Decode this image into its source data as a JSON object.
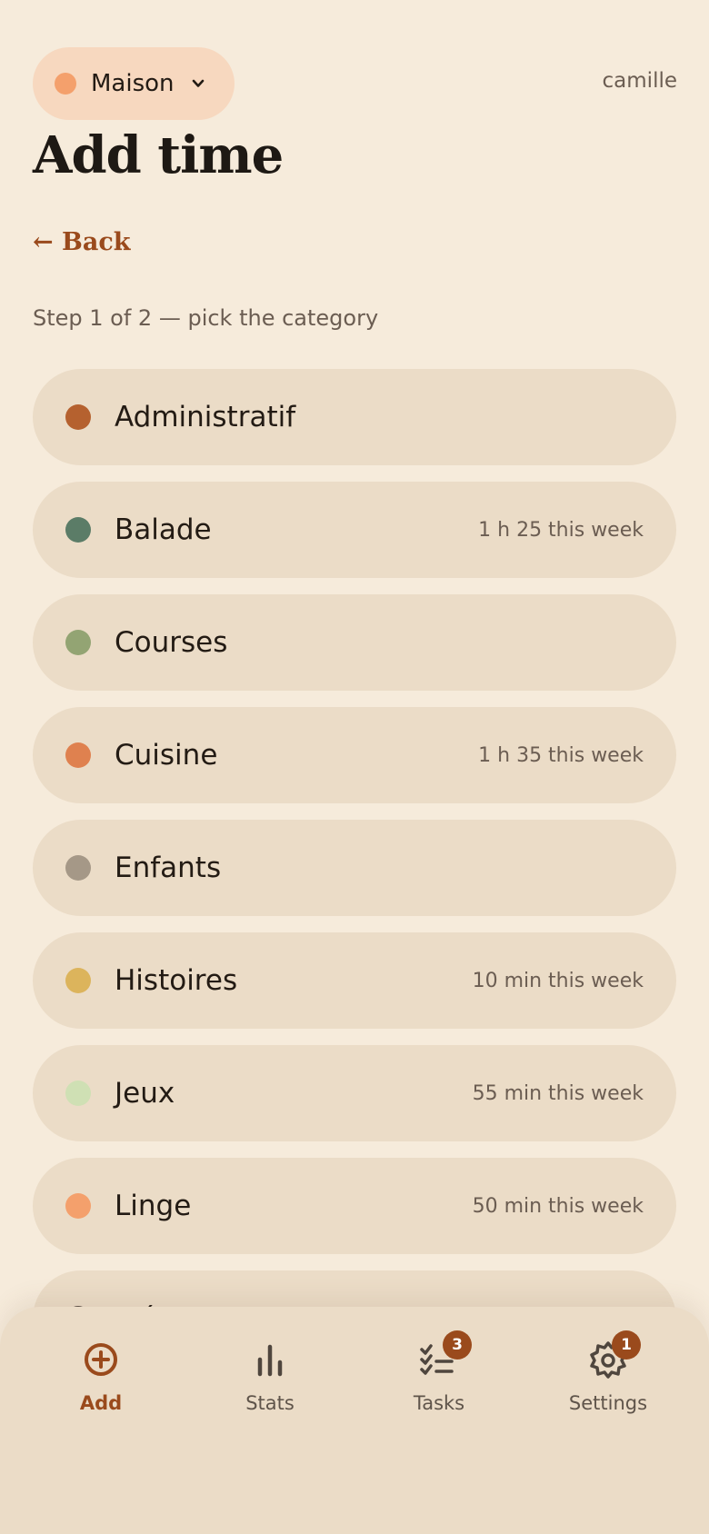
{
  "header": {
    "household": {
      "name": "Maison",
      "dot_color": "#f4a06c"
    },
    "user": "camille"
  },
  "title": "Add time",
  "back_label": "← Back",
  "step_text": "Step 1 of 2 — pick the category",
  "categories": [
    {
      "name": "Administratif",
      "color": "#b5612f",
      "week": ""
    },
    {
      "name": "Balade",
      "color": "#5b7c67",
      "week": "1 h 25 this week"
    },
    {
      "name": "Courses",
      "color": "#93a473",
      "week": ""
    },
    {
      "name": "Cuisine",
      "color": "#df814f",
      "week": "1 h 35 this week"
    },
    {
      "name": "Enfants",
      "color": "#a59887",
      "week": ""
    },
    {
      "name": "Histoires",
      "color": "#dcb45c",
      "week": "10 min this week"
    },
    {
      "name": "Jeux",
      "color": "#cfe0b4",
      "week": "55 min this week"
    },
    {
      "name": "Linge",
      "color": "#f4a06c",
      "week": "50 min this week"
    },
    {
      "name": "Ménage",
      "color": "#5b5048",
      "week": ""
    }
  ],
  "nav": {
    "add": {
      "label": "Add",
      "icon": "plus-circle-icon"
    },
    "stats": {
      "label": "Stats",
      "icon": "bar-chart-icon"
    },
    "tasks": {
      "label": "Tasks",
      "icon": "checklist-icon",
      "badge": "3"
    },
    "settings": {
      "label": "Settings",
      "icon": "gear-icon",
      "badge": "1"
    }
  },
  "colors": {
    "accent": "#9a4a1c",
    "background": "#f6ebdb",
    "row": "#ebdcc7"
  }
}
